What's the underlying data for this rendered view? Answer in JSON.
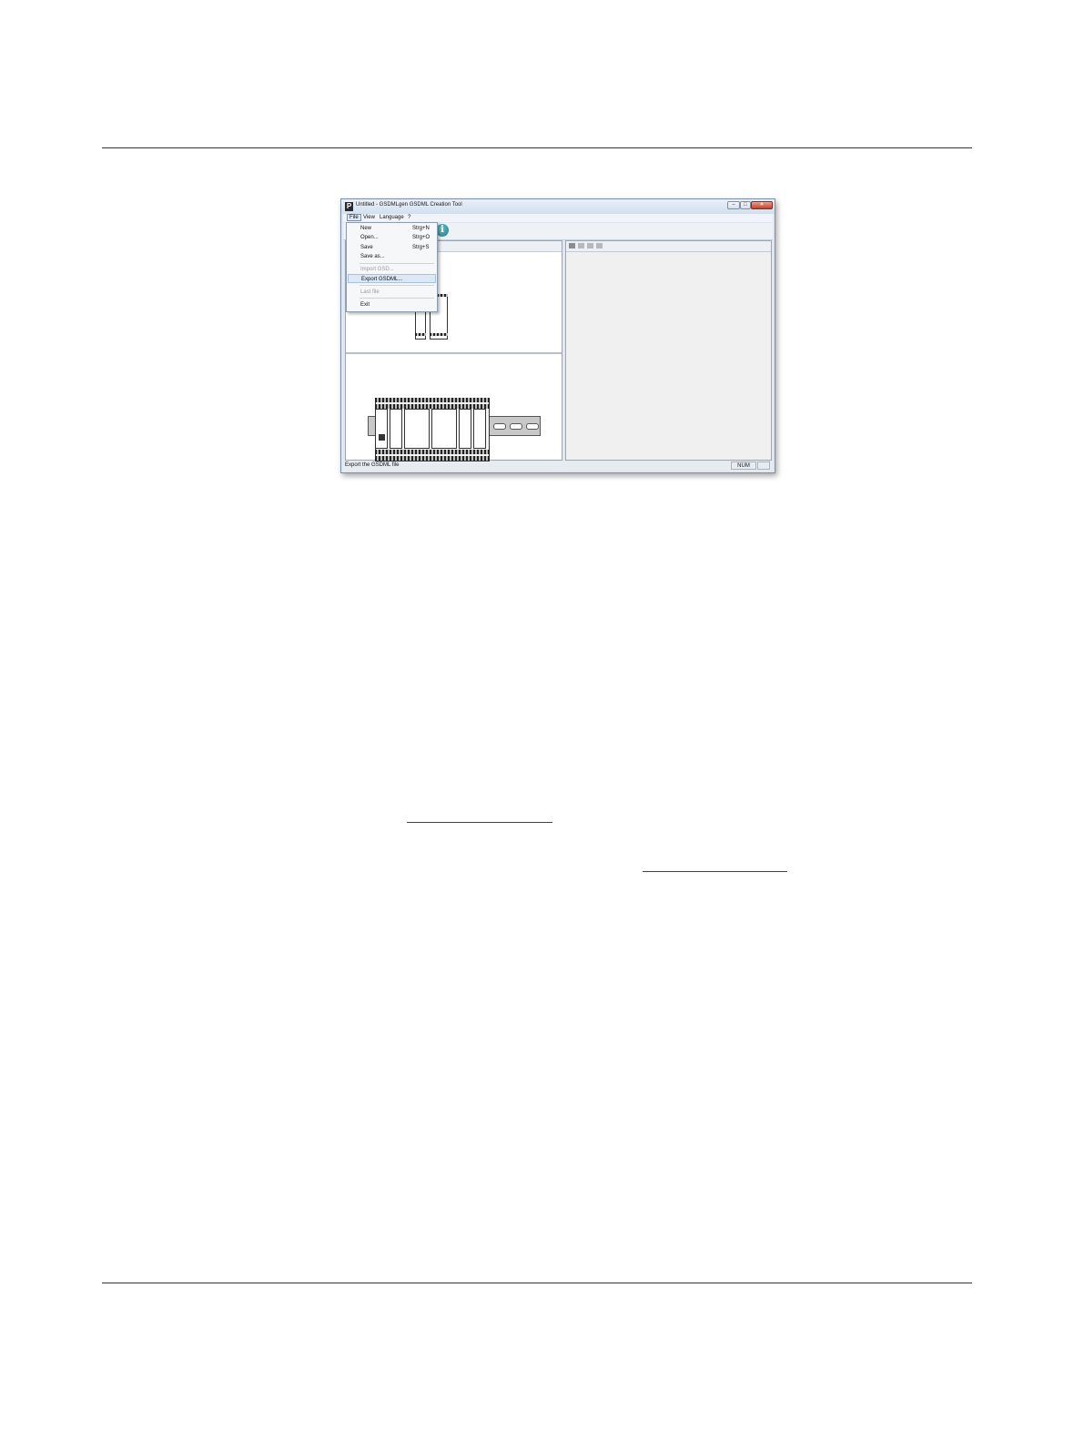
{
  "window": {
    "title": "Untitled - GSDMLgen GSDML Creation Tool",
    "app_icon_letter": "P",
    "controls": [
      "minimize-icon",
      "maximize-icon",
      "close-icon"
    ]
  },
  "menubar": {
    "file": "File",
    "view": "View",
    "language": "Language",
    "help": "?"
  },
  "toolbar": {
    "info_glyph": "i"
  },
  "file_menu": {
    "new": "New",
    "new_shortcut": "Strg+N",
    "open": "Open...",
    "open_shortcut": "Strg+O",
    "save": "Save",
    "save_shortcut": "Strg+S",
    "save_as": "Save as...",
    "import_gsd": "Import GSD...",
    "export_gsdml": "Export GSDML...",
    "last_file": "Last file",
    "exit": "Exit"
  },
  "statusbar": {
    "message": "Export the GSDML file",
    "num": "NUM"
  }
}
